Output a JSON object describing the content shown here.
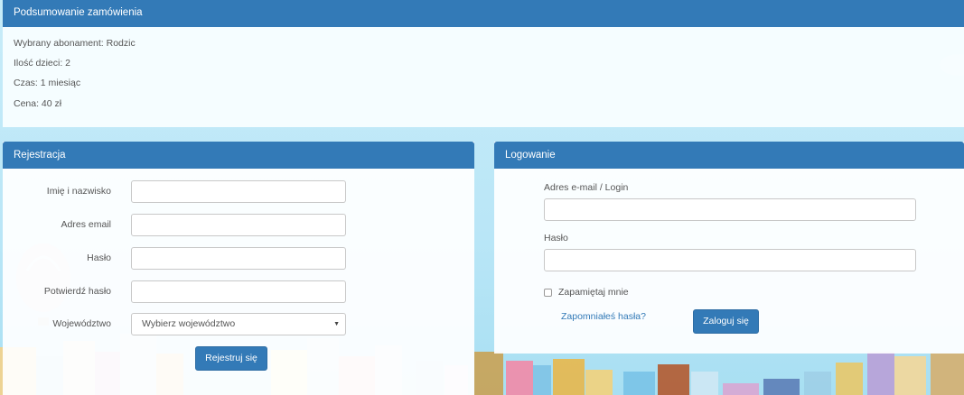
{
  "summary": {
    "title": "Podsumowanie zamówienia",
    "plan": "Wybrany abonament: Rodzic",
    "children": "Ilość dzieci: 2",
    "time": "Czas: 1 miesiąc",
    "price": "Cena: 40 zł"
  },
  "register": {
    "title": "Rejestracja",
    "name_label": "Imię i nazwisko",
    "email_label": "Adres email",
    "password_label": "Hasło",
    "confirm_label": "Potwierdź hasło",
    "province_label": "Województwo",
    "province_selected": "Wybierz województwo",
    "submit_label": "Rejestruj się"
  },
  "login": {
    "title": "Logowanie",
    "email_label": "Adres e-mail / Login",
    "password_label": "Hasło",
    "remember_label": "Zapamiętaj mnie",
    "forgot_label": "Zapomniałeś hasła?",
    "submit_label": "Zaloguj się"
  },
  "colors": {
    "accent": "#337ab7",
    "sky": "#b9e6f7"
  }
}
